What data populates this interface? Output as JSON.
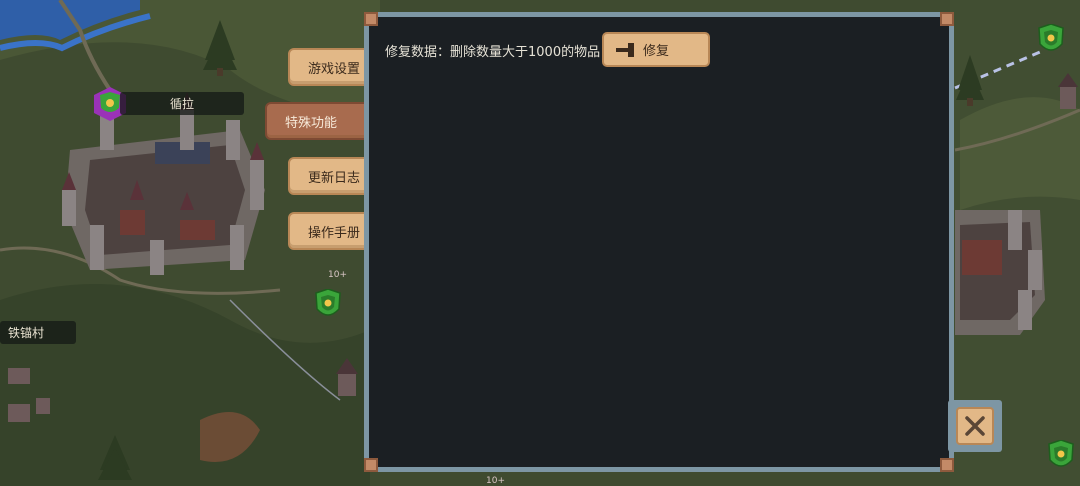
{
  "map": {
    "labels": {
      "town_main": "循拉",
      "village_left": "铁锚村"
    },
    "badges": {
      "badge_upper": "10+",
      "badge_lower": "10+"
    }
  },
  "menu": {
    "tabs": [
      {
        "label": "游戏设置",
        "active": false
      },
      {
        "label": "特殊功能",
        "active": true
      },
      {
        "label": "更新日志",
        "active": false
      },
      {
        "label": "操作手册",
        "active": false
      }
    ]
  },
  "panel": {
    "repair_description": "修复数据：删除数量大于1000的物品",
    "repair_button_label": "修复"
  },
  "colors": {
    "tab_bg": "#e2b887",
    "tab_active_bg": "#a86b4e",
    "panel_bg": "#1b1f23",
    "panel_border": "#7d96a4",
    "shield_green": "#3aa53a",
    "shield_purple": "#9a32b8"
  },
  "icons": {
    "repair": "hammer-icon",
    "close": "close-icon",
    "faction": "shield-icon"
  }
}
